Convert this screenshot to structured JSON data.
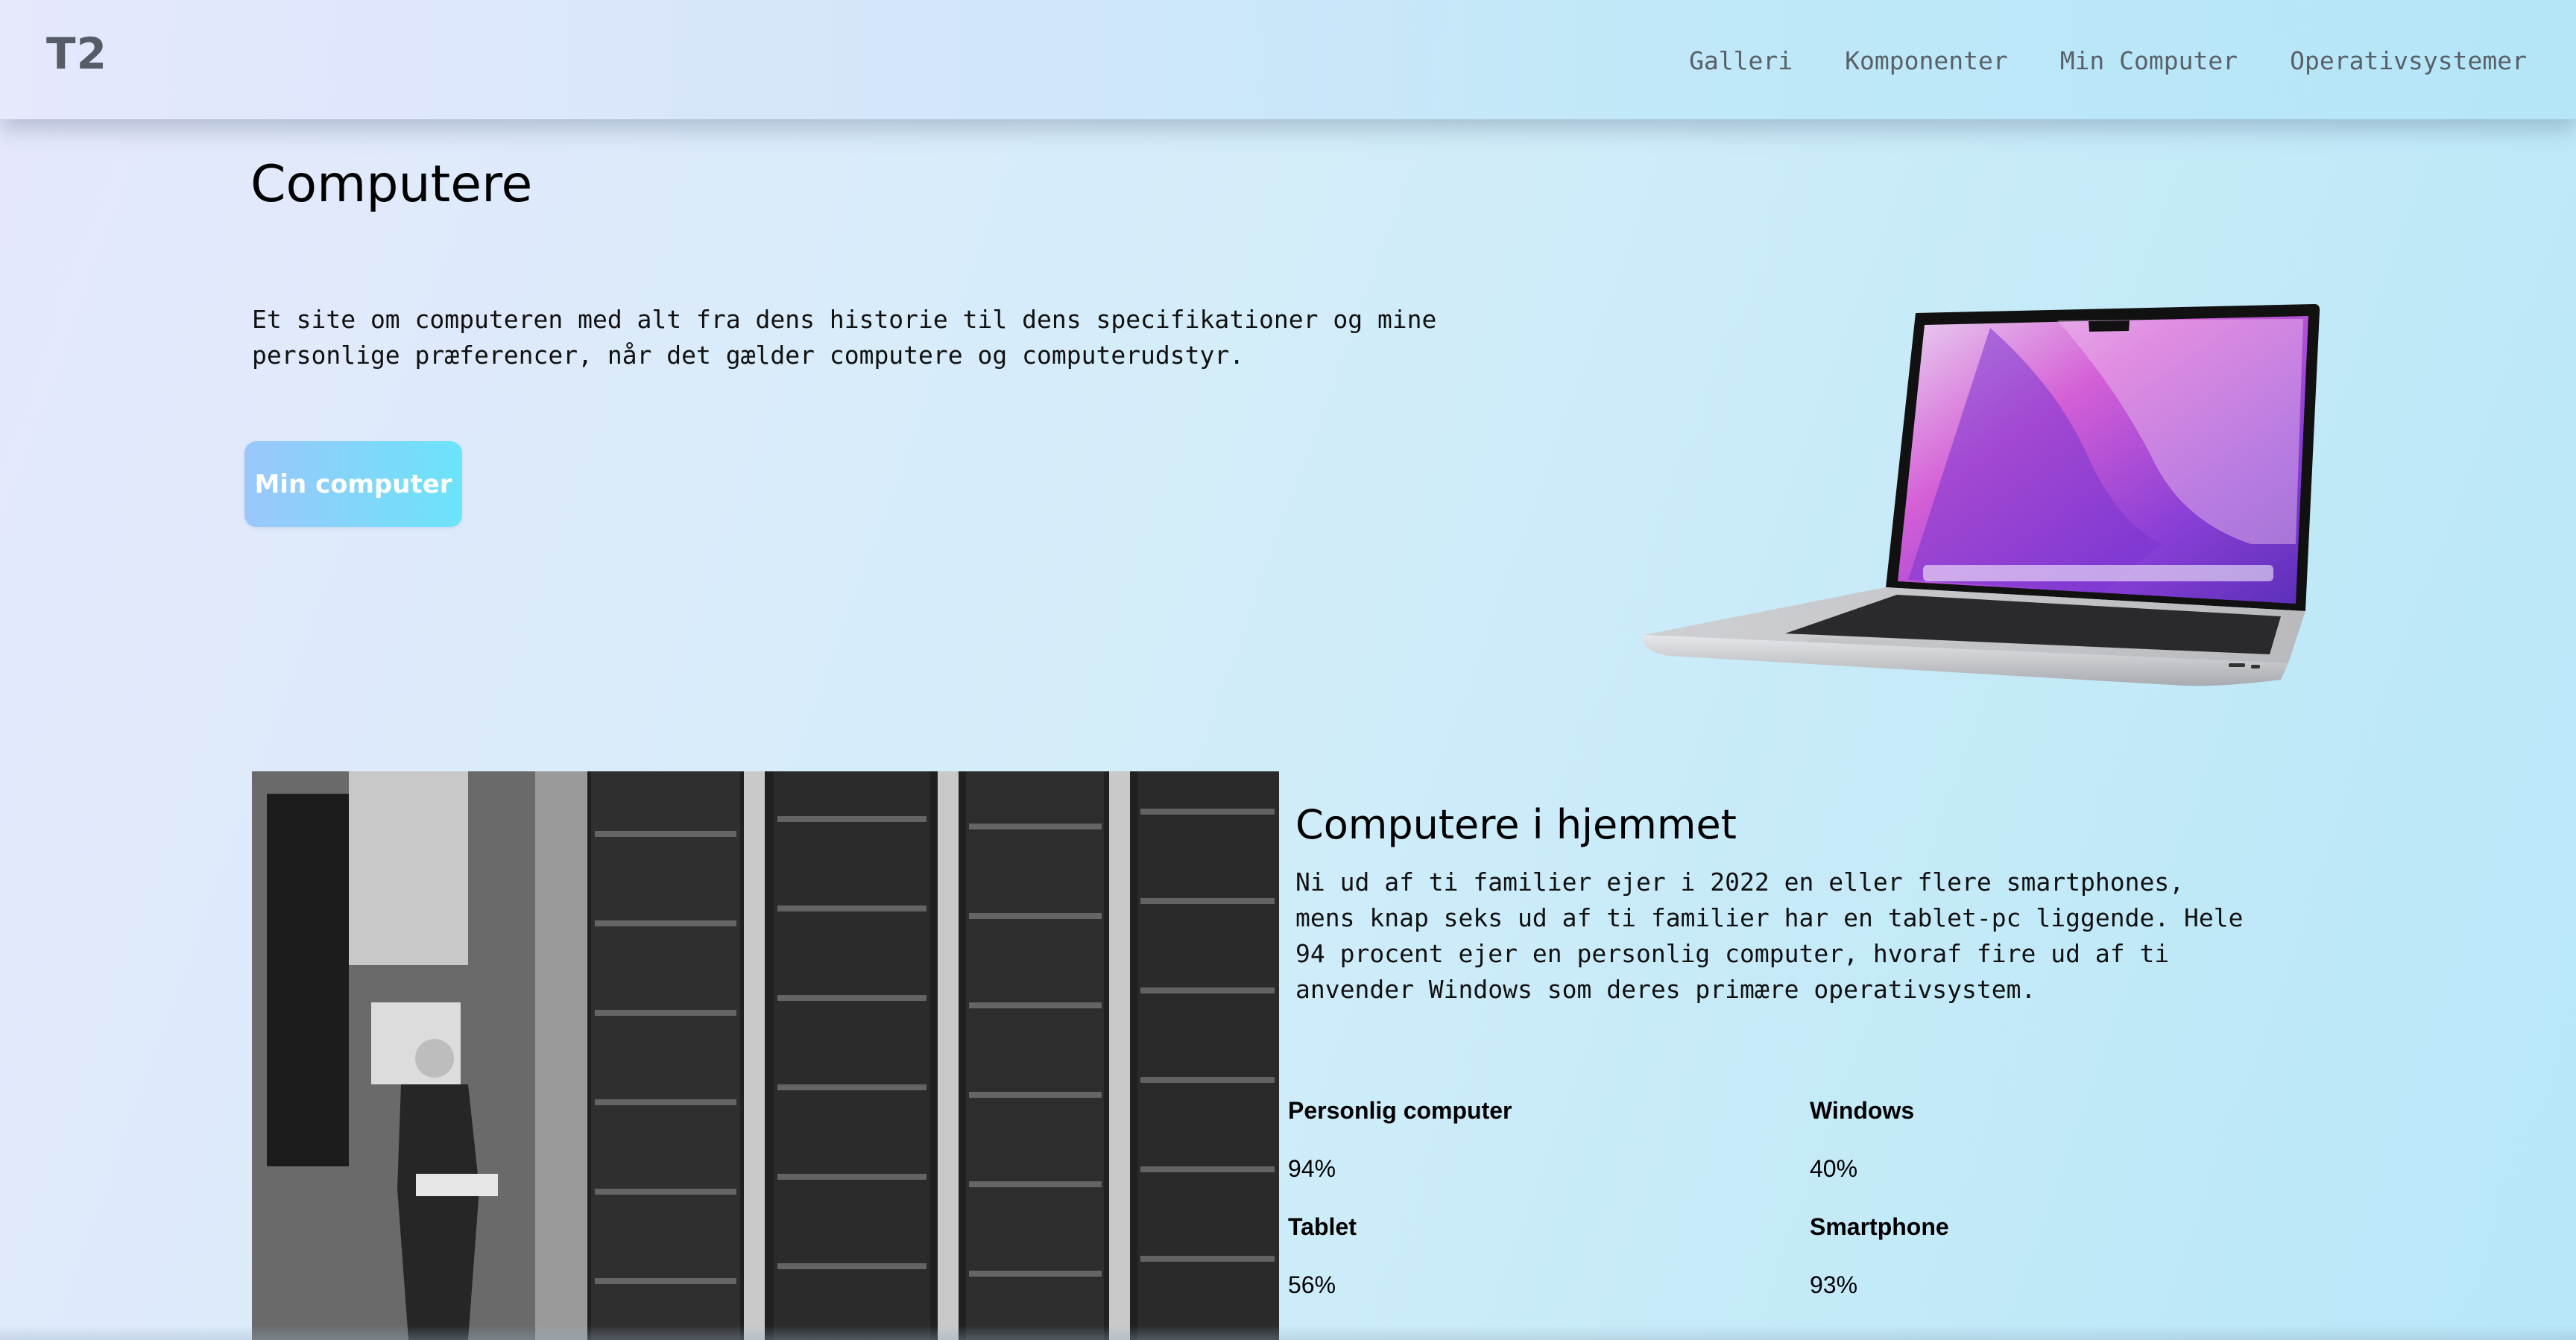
{
  "nav": {
    "logo": "T2",
    "links": [
      "Galleri",
      "Komponenter",
      "Min Computer",
      "Operativsystemer"
    ]
  },
  "hero": {
    "title": "Computere",
    "intro": "Et site om computeren med alt fra dens historie til dens specifikationer og mine personlige præferencer, når det gælder computere og computerudstyr.",
    "button_label": "Min computer"
  },
  "section": {
    "title": "Computere i hjemmet",
    "text": "Ni ud af ti familier ejer i 2022 en eller flere smartphones, mens knap seks ud af ti familier har en tablet-pc liggende. Hele 94 procent ejer en personlig computer, hvoraf fire ud af ti anvender Windows som deres primære operativsystem.",
    "stats": [
      {
        "label": "Personlig computer",
        "value": "94%"
      },
      {
        "label": "Windows",
        "value": "40%"
      },
      {
        "label": "Tablet",
        "value": "56%"
      },
      {
        "label": "Smartphone",
        "value": "93%"
      }
    ]
  },
  "colors": {
    "button_start": "#9cc6fa",
    "button_end": "#6be4f9",
    "nav_text": "#5a6068",
    "screen_purple": "#c03fd0"
  }
}
